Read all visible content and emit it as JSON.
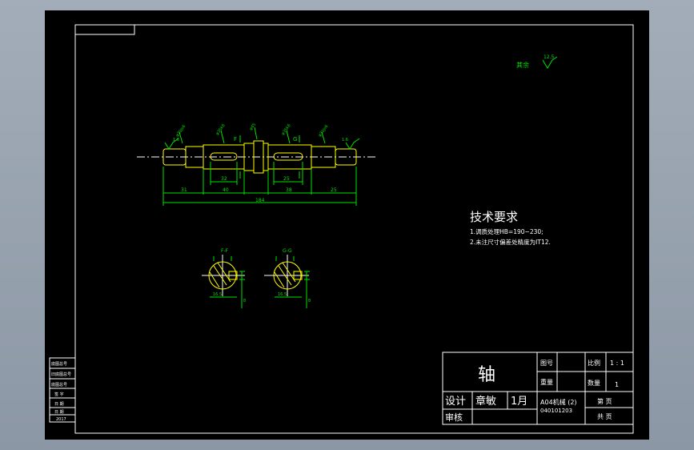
{
  "colors": {
    "sheet": "#000000",
    "border": "#ffffff",
    "dimension": "#00e000",
    "part": "#ffff00",
    "text": "#ffffff"
  },
  "drawing": {
    "roughness_note": "其余",
    "roughness_value": "12.5",
    "section_f_label": "F-F",
    "section_g_label": "G-G",
    "key_f_label": "F",
    "key_g_label": "G",
    "section_width_label": "16.5",
    "section_depth_label": "8",
    "dims": {
      "d1": "31",
      "d2": "40",
      "d3": "32",
      "d4": "25",
      "d5": "38",
      "d6": "25",
      "total": "184"
    },
    "roughness_left": "1.6",
    "roughness_right": "1.6",
    "tolerance_labels": [
      "φ30js6",
      "φ35k6",
      "φ45",
      "φ35k6",
      "φ30js6"
    ]
  },
  "tech": {
    "title": "技术要求",
    "line1": "1.调质处理HB=190~230;",
    "line2": "2.未注尺寸偏差处精度为IT12."
  },
  "side_stamp": {
    "cells": [
      "底图总号",
      "旧底图总号",
      "底图总号",
      "签 字",
      "日 期",
      "日 期",
      "2017"
    ]
  },
  "title_block": {
    "part_name": "轴",
    "drawing_no_label": "图号",
    "weight_label": "重量",
    "scale_label": "比例",
    "scale_value": "1 : 1",
    "qty_label": "数量",
    "qty_value": "1",
    "design_label": "设计",
    "designer": "章敏",
    "date": "1月",
    "review_label": "审核",
    "class_line": "A04机械 (2)",
    "student_no": "040101203",
    "sheet_label": "第  页",
    "total_label": "共  页"
  }
}
